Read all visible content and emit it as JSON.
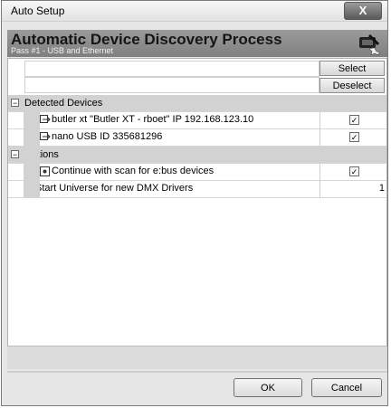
{
  "window": {
    "title": "Auto Setup",
    "close_label": "X"
  },
  "header": {
    "title": "Automatic Device Discovery Process",
    "subtitle": "Pass #1 - USB and Ethernet",
    "icon": "setup-wizard-icon"
  },
  "toolbar": {
    "select_label": "Select",
    "deselect_label": "Deselect"
  },
  "sections": [
    {
      "label": "Detected Devices",
      "expanded": true,
      "items": [
        {
          "label": "butler xt \"Butler XT - rboet\" IP 192.168.123.10",
          "icon": "network-device-icon",
          "checked": true
        },
        {
          "label": "nano USB ID 335681296",
          "icon": "usb-device-icon",
          "checked": true
        }
      ]
    },
    {
      "label": "Options",
      "expanded": true,
      "items": [
        {
          "label": "Continue with scan for e:bus devices",
          "icon": "bus-icon",
          "checked": true
        },
        {
          "label": "Start Universe for new DMX Drivers",
          "value": "1"
        }
      ]
    }
  ],
  "buttons": {
    "ok_label": "OK",
    "cancel_label": "Cancel"
  }
}
